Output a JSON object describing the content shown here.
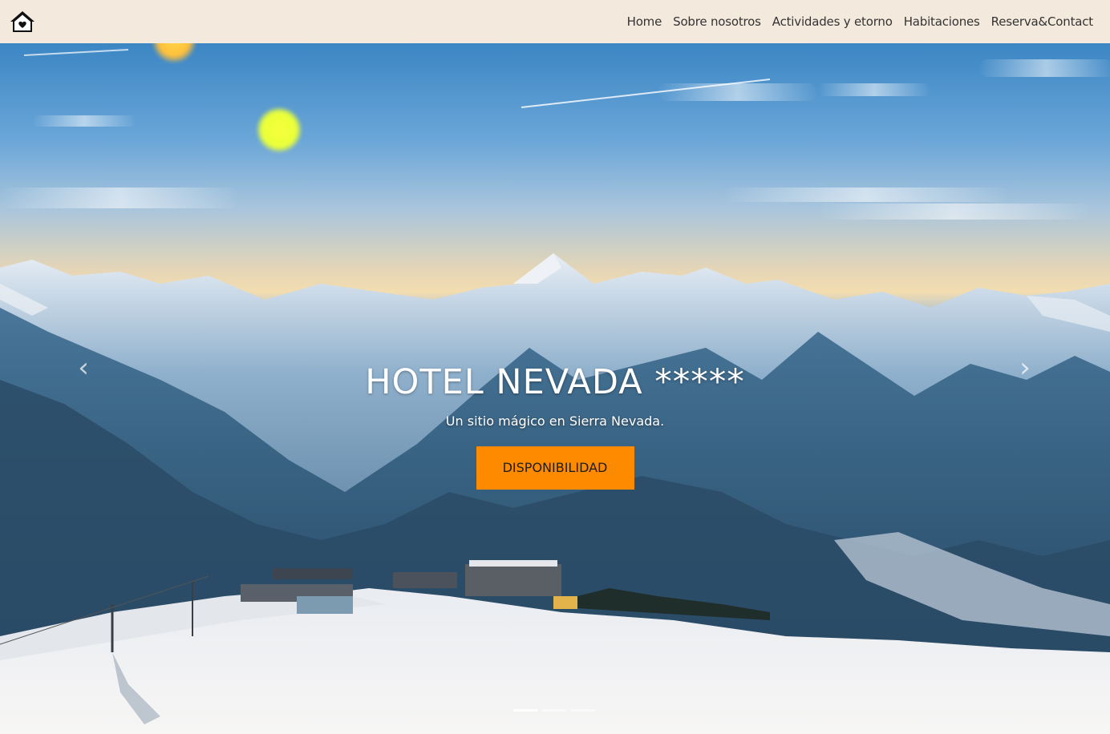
{
  "navbar": {
    "brand_icon": "house-heart-icon",
    "links": [
      {
        "label": "Home"
      },
      {
        "label": "Sobre nosotros"
      },
      {
        "label": "Actividades y etorno"
      },
      {
        "label": "Habitaciones"
      },
      {
        "label": "Reserva&Contact"
      }
    ]
  },
  "hero": {
    "title": "HOTEL NEVADA *****",
    "subtitle": "Un sitio mágico en Sierra Nevada.",
    "cta_label": "DISPONIBILIDAD",
    "prev_icon": "chevron-left-icon",
    "next_icon": "chevron-right-icon",
    "prev_glyph": "‹",
    "next_glyph": "›",
    "slides_count": 3,
    "active_slide": 1
  },
  "colors": {
    "navbar_bg": "#f3e9dc",
    "cta_bg": "#fe8a00",
    "text_dark": "#333333"
  }
}
